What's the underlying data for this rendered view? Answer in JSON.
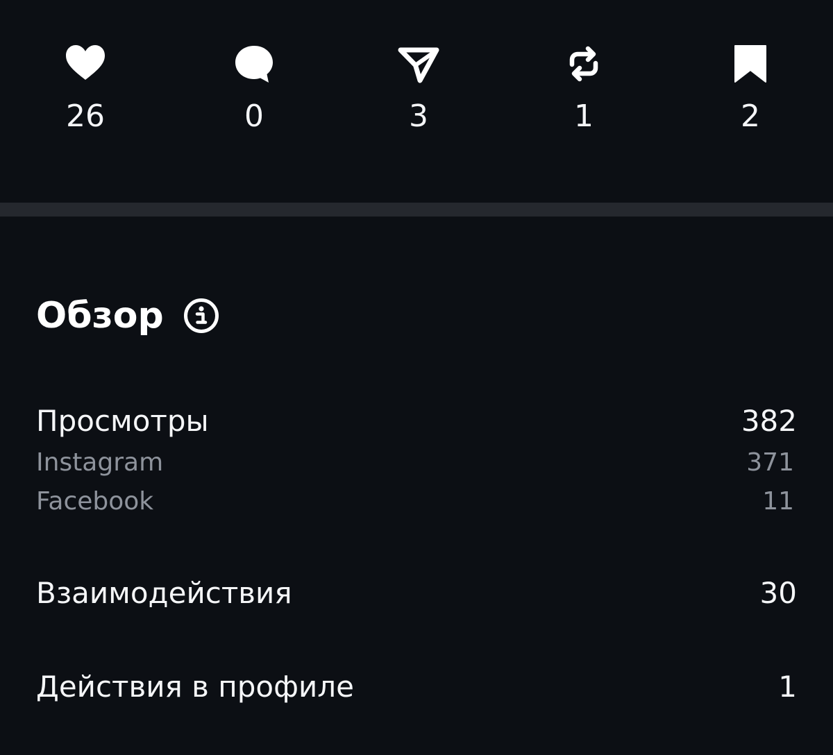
{
  "stats": {
    "likes": {
      "icon": "heart-icon",
      "count": "26"
    },
    "comments": {
      "icon": "comment-bubble-icon",
      "count": "0"
    },
    "shares": {
      "icon": "send-icon",
      "count": "3"
    },
    "reposts": {
      "icon": "repost-icon",
      "count": "1"
    },
    "saves": {
      "icon": "bookmark-icon",
      "count": "2"
    }
  },
  "overview": {
    "title": "Обзор",
    "info_icon": "info-icon",
    "views": {
      "label": "Просмотры",
      "value": "382",
      "breakdown": [
        {
          "label": "Instagram",
          "value": "371"
        },
        {
          "label": "Facebook",
          "value": "11"
        }
      ]
    },
    "interactions": {
      "label": "Взаимодействия",
      "value": "30"
    },
    "profile_actions": {
      "label": "Действия в профиле",
      "value": "1"
    }
  },
  "colors": {
    "background": "#0c0f14",
    "divider": "#25282e",
    "text_primary": "#f5f6f8",
    "text_secondary": "#8e939c"
  }
}
